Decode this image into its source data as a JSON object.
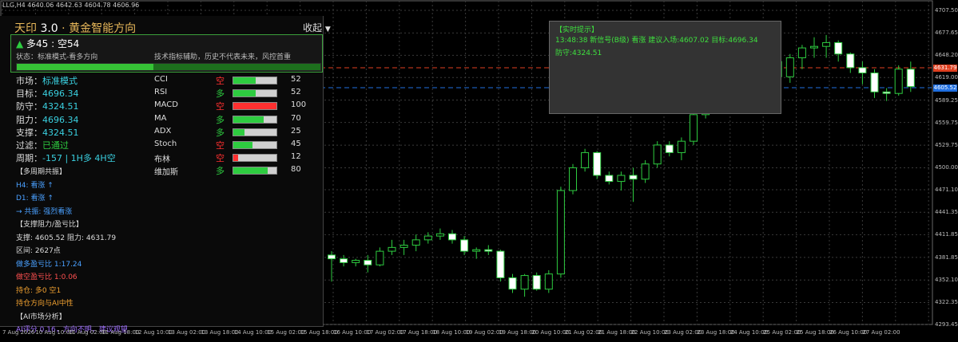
{
  "symbol_line": "LLG,H4  4640.06 4642.63 4604.78 4606.96",
  "panel": {
    "title_prefix": "天印 ",
    "title_version": "3.0",
    "title_suffix": " · 黄金智能方向",
    "collapse_label": "收起",
    "collapse_arrow": "▼",
    "signal_arrow": "▲",
    "signal_text": " 多45 : 空54",
    "status": "状态：标准模式-看多方向",
    "note": "技术指标辅助，历史不代表未来，风控首重",
    "progress": 0.45,
    "fields": [
      {
        "label": "市场：",
        "value": "标准模式",
        "color": "cyan"
      },
      {
        "label": "目标：",
        "value": "4696.34",
        "color": "cyan"
      },
      {
        "label": "防守：",
        "value": "4324.51",
        "color": "cyan"
      },
      {
        "label": "阻力：",
        "value": "4696.34",
        "color": "cyan"
      },
      {
        "label": "支撑：",
        "value": "4324.51",
        "color": "cyan"
      },
      {
        "label": "过滤：",
        "value": "已通过",
        "color": "green"
      },
      {
        "label": "周期：",
        "value": "-157 | 1H多 4H空",
        "color": "cyan"
      }
    ],
    "indicators": [
      {
        "name": "CCI",
        "dir": "空",
        "score": 52,
        "barcolor": "#2ecc40",
        "dircolor": "red"
      },
      {
        "name": "RSI",
        "dir": "多",
        "score": 52,
        "barcolor": "#2ecc40",
        "dircolor": "green"
      },
      {
        "name": "MACD",
        "dir": "空",
        "score": 100,
        "barcolor": "#ff3030",
        "dircolor": "red"
      },
      {
        "name": "MA",
        "dir": "多",
        "score": 70,
        "barcolor": "#2ecc40",
        "dircolor": "green"
      },
      {
        "name": "ADX",
        "dir": "多",
        "score": 25,
        "barcolor": "#2ecc40",
        "dircolor": "green"
      },
      {
        "name": "Stoch",
        "dir": "空",
        "score": 45,
        "barcolor": "#2ecc40",
        "dircolor": "red"
      },
      {
        "name": "布林",
        "dir": "空",
        "score": 12,
        "barcolor": "#ff3030",
        "dircolor": "red"
      },
      {
        "name": "维加斯",
        "dir": "多",
        "score": 80,
        "barcolor": "#2ecc40",
        "dircolor": "green"
      }
    ],
    "lines": [
      {
        "text": "【多周期共振】",
        "color": "#ddd"
      },
      {
        "text": "H4: 看涨 ↑",
        "color": "#4aa0ff"
      },
      {
        "text": "D1: 看涨 ↑",
        "color": "#4aa0ff"
      },
      {
        "text": "→ 共振: 强烈看涨",
        "color": "#4aa0ff"
      },
      {
        "text": "【支撑阻力/盈亏比】",
        "color": "#ddd"
      },
      {
        "text": "支撑: 4605.52  阻力: 4631.79",
        "color": "#ddd"
      },
      {
        "text": "区间: 2627点",
        "color": "#ddd"
      },
      {
        "text": "做多盈亏比 1:17.24",
        "color": "#4aa0ff"
      },
      {
        "text": "做空盈亏比 1:0.06",
        "color": "#ff5050"
      },
      {
        "text": "持仓: 多0 空1",
        "color": "#f0a030"
      },
      {
        "text": "持仓方向与AI中性",
        "color": "#f0a030"
      },
      {
        "text": "【AI市场分析】",
        "color": "#ddd"
      },
      {
        "text": "AI评分 0.16，方向不明，建议观望",
        "color": "#a070ff"
      }
    ]
  },
  "popup": {
    "title": "【实时提示】",
    "line1": "13:48:38 新信号(B级) 看涨 建议入场:4607.02 目标:4696.34",
    "line2": "防守:4324.51"
  },
  "price_axis": [
    "4707.50",
    "4677.65",
    "4648.20",
    "4619.00",
    "4589.25",
    "4559.75",
    "4529.75",
    "4500.00",
    "4471.10",
    "4441.35",
    "4411.85",
    "4381.85",
    "4352.10",
    "4322.35",
    "4293.45"
  ],
  "price_tags": [
    {
      "value": "4631.79",
      "color": "#e04020"
    },
    {
      "value": "4605.52",
      "color": "#1f6fe0"
    }
  ],
  "time_axis": [
    "7 Aug 2026",
    "10 Aug 10:00",
    "11 Aug 02:00",
    "11 Aug 18:00",
    "12 Aug 10:00",
    "13 Aug 02:00",
    "13 Aug 18:00",
    "14 Aug 10:00",
    "15 Aug 02:00",
    "15 Aug 18:00",
    "16 Aug 10:00",
    "17 Aug 02:00",
    "17 Aug 18:00",
    "18 Aug 10:00",
    "19 Aug 02:00",
    "19 Aug 18:00",
    "20 Aug 10:00",
    "21 Aug 02:00",
    "21 Aug 18:00",
    "22 Aug 10:00",
    "23 Aug 02:00",
    "23 Aug 18:00",
    "24 Aug 10:00",
    "25 Aug 02:00",
    "25 Aug 18:00",
    "26 Aug 10:00",
    "27 Aug 02:00"
  ],
  "candles": [
    [
      4385,
      4390,
      4350,
      4380
    ],
    [
      4380,
      4385,
      4370,
      4375
    ],
    [
      4375,
      4380,
      4370,
      4378
    ],
    [
      4378,
      4385,
      4362,
      4372
    ],
    [
      4372,
      4395,
      4370,
      4390
    ],
    [
      4390,
      4405,
      4385,
      4395
    ],
    [
      4395,
      4405,
      4385,
      4398
    ],
    [
      4398,
      4412,
      4390,
      4405
    ],
    [
      4405,
      4415,
      4400,
      4410
    ],
    [
      4410,
      4420,
      4405,
      4413
    ],
    [
      4413,
      4418,
      4400,
      4405
    ],
    [
      4405,
      4410,
      4385,
      4390
    ],
    [
      4390,
      4395,
      4380,
      4392
    ],
    [
      4392,
      4398,
      4385,
      4390
    ],
    [
      4390,
      4392,
      4350,
      4355
    ],
    [
      4355,
      4360,
      4335,
      4340
    ],
    [
      4340,
      4360,
      4330,
      4358
    ],
    [
      4358,
      4362,
      4338,
      4340
    ],
    [
      4340,
      4365,
      4335,
      4360
    ],
    [
      4360,
      4475,
      4355,
      4470
    ],
    [
      4470,
      4505,
      4465,
      4500
    ],
    [
      4500,
      4525,
      4495,
      4520
    ],
    [
      4520,
      4522,
      4485,
      4490
    ],
    [
      4490,
      4495,
      4478,
      4482
    ],
    [
      4482,
      4495,
      4470,
      4490
    ],
    [
      4490,
      4500,
      4455,
      4485
    ],
    [
      4485,
      4510,
      4480,
      4505
    ],
    [
      4505,
      4535,
      4500,
      4530
    ],
    [
      4530,
      4535,
      4515,
      4520
    ],
    [
      4520,
      4540,
      4510,
      4535
    ],
    [
      4535,
      4580,
      4530,
      4570
    ],
    [
      4570,
      4620,
      4565,
      4610
    ],
    [
      4610,
      4640,
      4600,
      4630
    ],
    [
      4630,
      4655,
      4620,
      4645
    ],
    [
      4645,
      4670,
      4640,
      4660
    ],
    [
      4660,
      4668,
      4640,
      4645
    ],
    [
      4645,
      4660,
      4620,
      4640
    ],
    [
      4640,
      4655,
      4615,
      4620
    ],
    [
      4620,
      4650,
      4612,
      4645
    ],
    [
      4645,
      4662,
      4630,
      4658
    ],
    [
      4658,
      4672,
      4645,
      4660
    ],
    [
      4660,
      4675,
      4645,
      4665
    ],
    [
      4665,
      4668,
      4640,
      4650
    ],
    [
      4650,
      4652,
      4625,
      4632
    ],
    [
      4632,
      4640,
      4610,
      4625
    ],
    [
      4625,
      4630,
      4592,
      4600
    ],
    [
      4600,
      4605,
      4588,
      4598
    ],
    [
      4598,
      4635,
      4595,
      4630
    ],
    [
      4630,
      4640,
      4600,
      4607
    ]
  ]
}
